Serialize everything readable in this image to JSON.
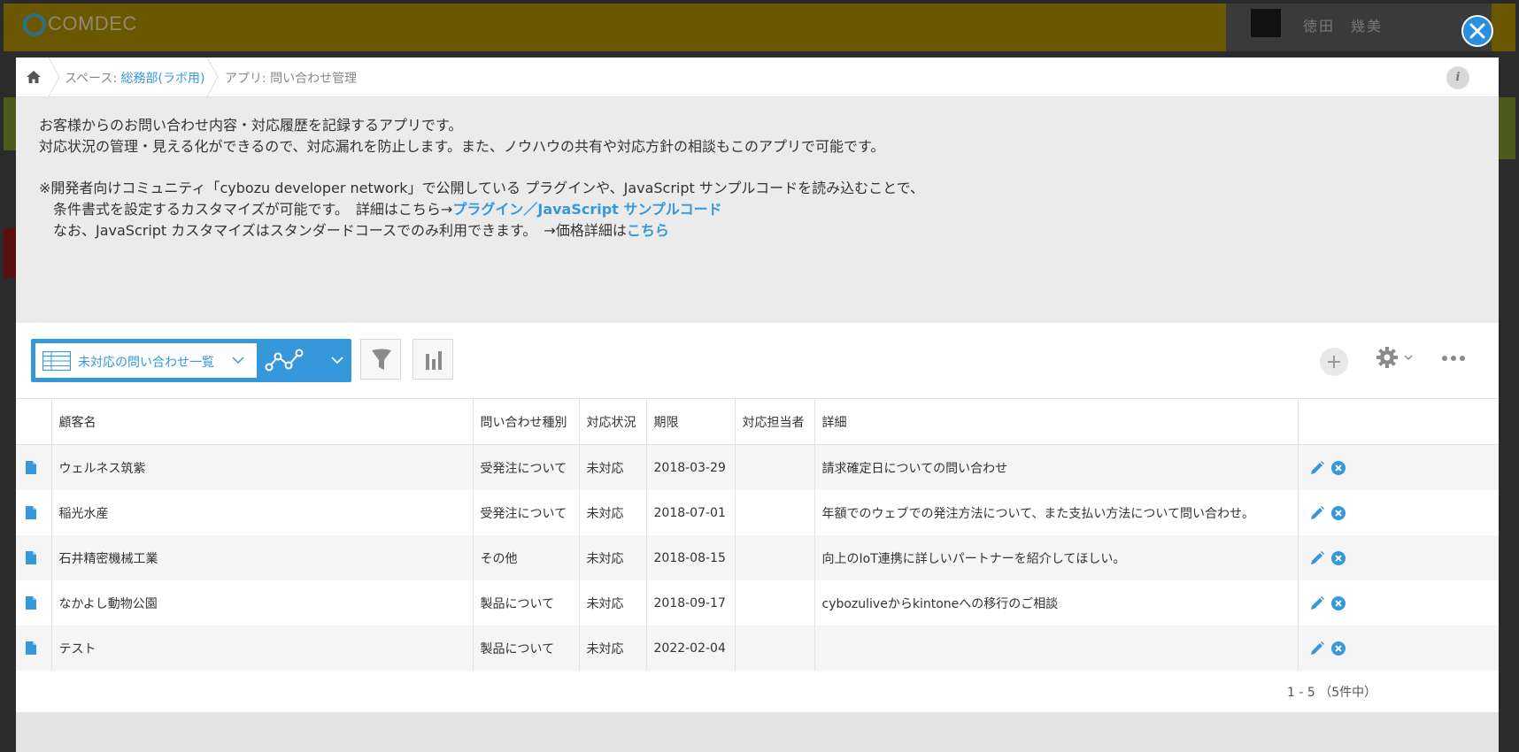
{
  "background": {
    "logo_text": "COMDEC",
    "user_name": "徳田　幾美"
  },
  "breadcrumb": {
    "space_prefix": "スペース: ",
    "space_name": "総務部(ラボ用)",
    "app_prefix": "アプリ: ",
    "app_name": "問い合わせ管理",
    "info_label": "i"
  },
  "description": {
    "line1": "お客様からのお問い合わせ内容・対応履歴を記録するアプリです。",
    "line2": "対応状況の管理・見える化ができるので、対応漏れを防止します。また、ノウハウの共有や対応方針の相談もこのアプリで可能です。",
    "line3": "※開発者向けコミュニティ「cybozu developer network」で公開している プラグインや、JavaScript サンプルコードを読み込むことで、",
    "line4_text": "条件書式を設定するカスタマイズが可能です。　詳細はこちら→",
    "line4_link1": "プラグイン",
    "line4_sep": "／",
    "line4_link2": "JavaScript サンプルコード",
    "line5_text": "なお、JavaScript カスタマイズはスタンダードコースでのみ利用できます。　→価格詳細は",
    "line5_link": "こちら"
  },
  "toolbar": {
    "view_name": "未対応の問い合わせ一覧",
    "icons": [
      "table-icon",
      "graph-icon",
      "filter-icon",
      "bar-chart-icon",
      "plus-icon",
      "gear-icon",
      "more-icon"
    ]
  },
  "table": {
    "columns": [
      "",
      "顧客名",
      "問い合わせ種別",
      "対応状況",
      "期限",
      "対応担当者",
      "詳細",
      ""
    ],
    "rows": [
      {
        "customer": "ウェルネス筑紫",
        "type": "受発注について",
        "status": "未対応",
        "due": "2018-03-29",
        "assignee": "",
        "detail": "請求確定日についての問い合わせ"
      },
      {
        "customer": "稲光水産",
        "type": "受発注について",
        "status": "未対応",
        "due": "2018-07-01",
        "assignee": "",
        "detail": "年額でのウェブでの発注方法について、また支払い方法について問い合わせ。"
      },
      {
        "customer": "石井精密機械工業",
        "type": "その他",
        "status": "未対応",
        "due": "2018-08-15",
        "assignee": "",
        "detail": "向上のIoT連携に詳しいパートナーを紹介してほしい。"
      },
      {
        "customer": "なかよし動物公園",
        "type": "製品について",
        "status": "未対応",
        "due": "2018-09-17",
        "assignee": "",
        "detail": "cybozuliveからkintoneへの移行のご相談"
      },
      {
        "customer": "テスト",
        "type": "製品について",
        "status": "未対応",
        "due": "2022-02-04",
        "assignee": "",
        "detail": ""
      }
    ]
  },
  "pager": {
    "text": "1 - 5 （5件中）"
  },
  "colors": {
    "accent": "#3498db",
    "close_button": "#2a8fde",
    "header_bg": "#6b5700"
  }
}
